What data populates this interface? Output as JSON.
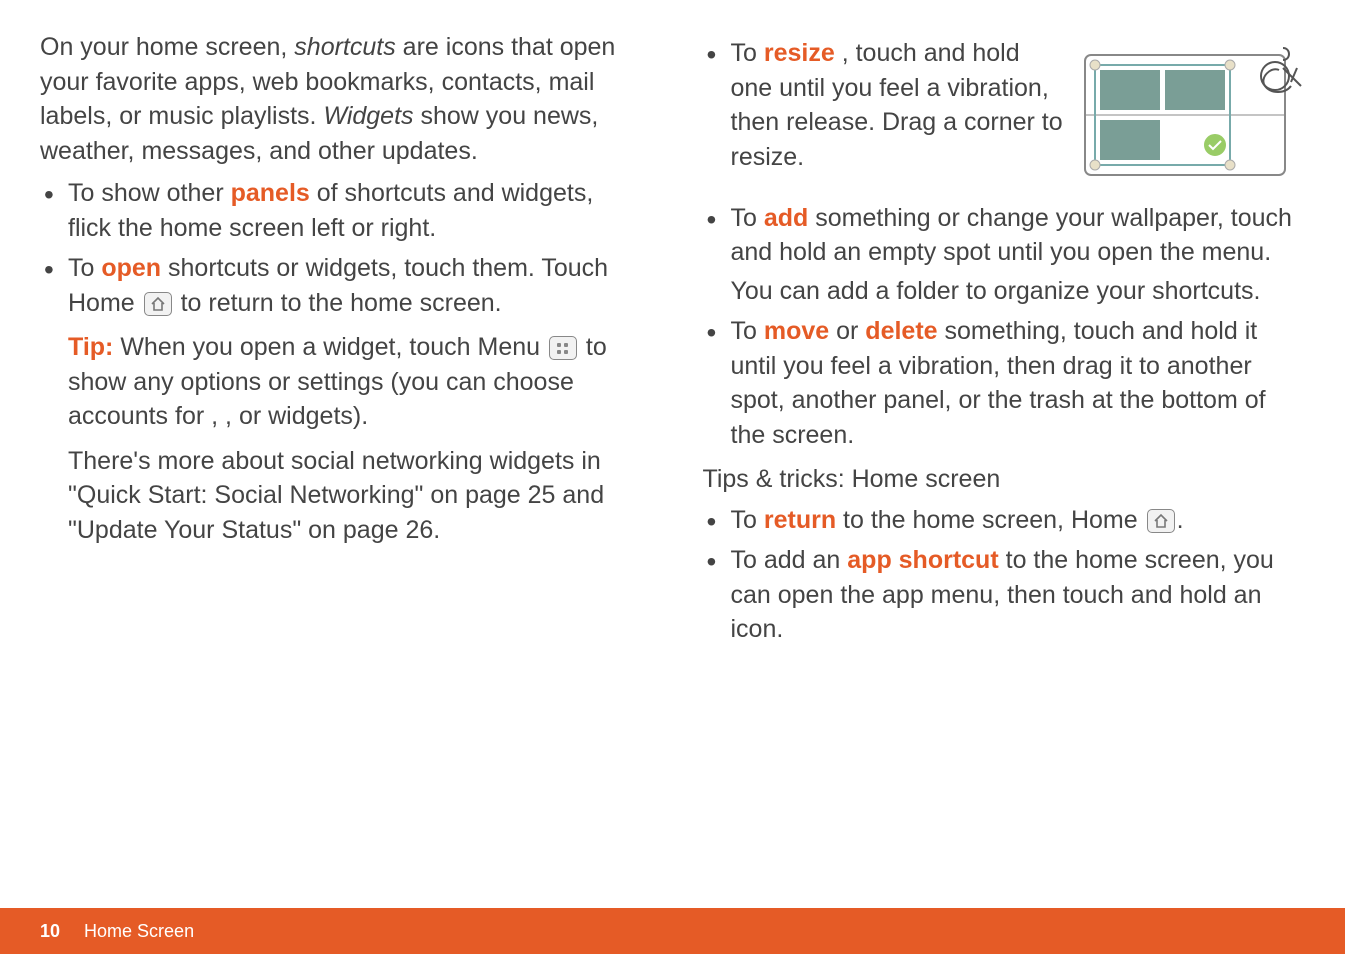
{
  "left": {
    "intro": {
      "a": "On your home screen, ",
      "shortcuts": "shortcuts",
      "b": " are icons that open your favorite apps, web bookmarks, contacts, mail labels, or music playlists. ",
      "widgets": "Widgets",
      "c": " show you news, weather, messages, and other updates."
    },
    "panels": {
      "a": "To show other ",
      "kw": "panels",
      "b": " of shortcuts and widgets, flick the home screen left or right."
    },
    "open": {
      "a": "To ",
      "kw": "open",
      "b": " shortcuts or widgets, touch them. Touch Home ",
      "c": " to return to the home screen."
    },
    "tip": {
      "label": "Tip:",
      "a": " When you open a widget, touch Menu ",
      "b": " to show any options or settings (you can choose accounts for ",
      "c": ", ",
      "d": ", or ",
      "e": " widgets)."
    },
    "more": "There's more about social networking widgets in \"Quick Start: Social Networking\" on page 25 and \"Update Your Status\" on page 26."
  },
  "right": {
    "resize": {
      "a": "To ",
      "kw": "resize",
      "b": " ",
      "c": ", touch and hold one until you feel a vibration, then release. Drag a corner to resize."
    },
    "add": {
      "a": "To ",
      "kw": "add",
      "b": " something or change your wallpaper, touch and hold an empty spot until you open the ",
      "c": " menu."
    },
    "add2": "You can add a folder to organize your shortcuts.",
    "movedel": {
      "a": "To ",
      "move": "move",
      "or": " or ",
      "del": "delete",
      "b": " something, touch and hold it until you feel a vibration, then drag it to another spot, another panel, or the trash at the bottom of the screen."
    },
    "tips_heading": "Tips & tricks: Home screen",
    "return": {
      "a": "To ",
      "kw": "return",
      "b": " to the home screen, Home ",
      "c": "."
    },
    "shortcut": {
      "a": "To add an ",
      "kw": "app shortcut",
      "b": " to the home screen, you can open the app menu, then touch and hold an icon."
    }
  },
  "footer": {
    "page": "10",
    "section": "Home Screen"
  }
}
